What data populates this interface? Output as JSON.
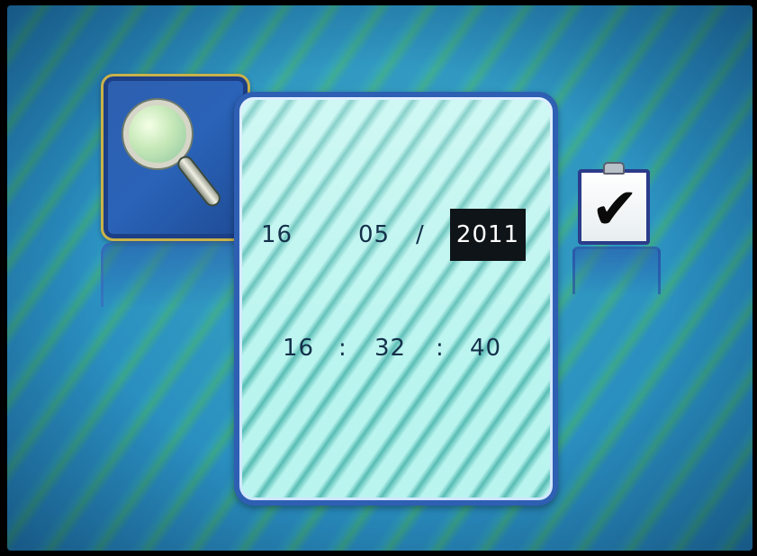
{
  "date": {
    "day": "16",
    "month": "05",
    "separator": "/",
    "year": "2011"
  },
  "time": {
    "hour": "16",
    "minute": "32",
    "second": "40",
    "separator": ":"
  },
  "icons": {
    "search": "magnifying-glass-icon",
    "confirm": "clipboard-check-icon"
  },
  "colors": {
    "selected_bg": "#0e1418",
    "panel_border": "#2f5fb3",
    "tile_highlight": "#c9b24a"
  }
}
